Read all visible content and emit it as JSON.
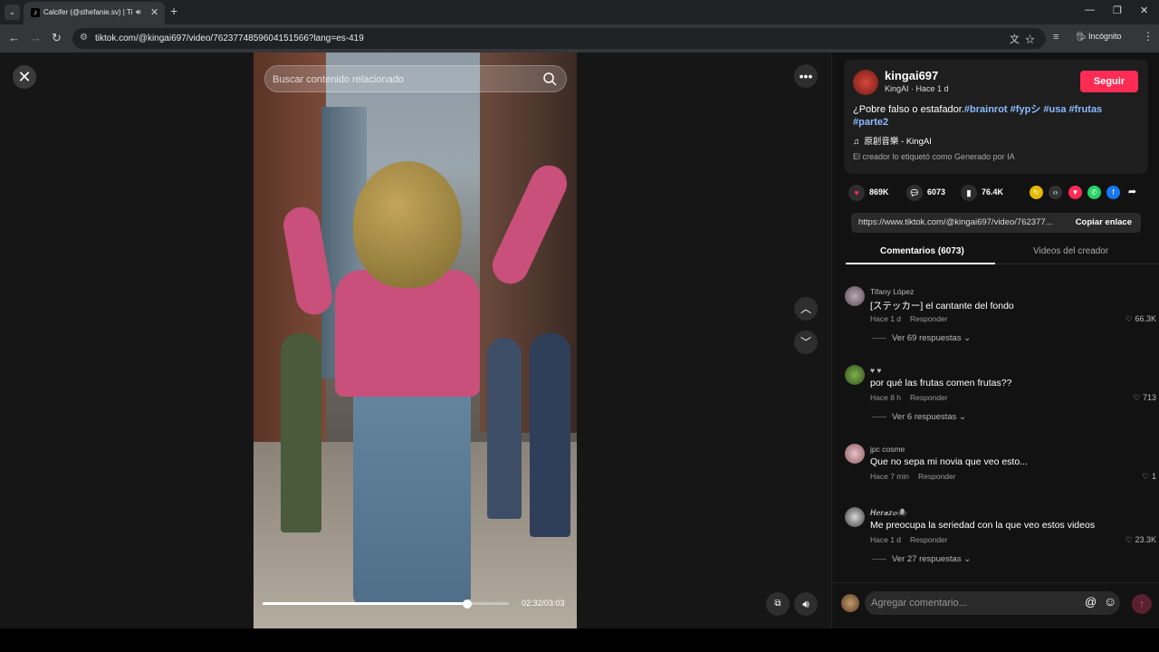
{
  "browser": {
    "tab_title": "Calcifer (@sthefanie.sv) | Ti",
    "url": "tiktok.com/@kingai697/video/7623774859604151566?lang=es-419",
    "incognito_label": "Incógnito"
  },
  "video": {
    "search_placeholder": "Buscar contenido relacionado",
    "time": "02:32/03:03",
    "progress_fraction": 0.83
  },
  "author": {
    "username": "kingai697",
    "subtitle": "KingAI · Hace 1 d",
    "follow_label": "Seguir",
    "desc_text": "¿Pobre falso o estafador.",
    "hashtags": [
      "#brainrot",
      "#fypシ",
      "#usa",
      "#frutas",
      "#parte2"
    ],
    "music": "原創音樂 - KingAI",
    "ai_label": "El creador lo etiquetó como Generado por IA"
  },
  "stats": {
    "likes": "869K",
    "comments": "6073",
    "saves": "76.4K"
  },
  "share": {
    "link": "https://www.tiktok.com/@kingai697/video/762377...",
    "copy_label": "Copiar enlace"
  },
  "tabs": {
    "comments": "Comentarios (6073)",
    "creator_videos": "Videos del creador"
  },
  "comments": [
    {
      "user": "Tifany López",
      "text": "[ステッカー] el cantante del fondo",
      "time": "Hace 1 d",
      "reply": "Responder",
      "likes": "66.3K",
      "more": "Ver 69 respuestas"
    },
    {
      "user": "♥ ♥",
      "text": "por qué las frutas comen frutas??",
      "time": "Hace 8 h",
      "reply": "Responder",
      "likes": "713",
      "more": "Ver 6 respuestas"
    },
    {
      "user": "jpc cosme",
      "text": "Que no sepa mi novia que veo esto...",
      "time": "Hace 7 min",
      "reply": "Responder",
      "likes": "1",
      "more": ""
    },
    {
      "user": "𝑯𝒆𝒓𝒂𝒛𝒐🕷",
      "text": "Me preocupa la seriedad con la que veo estos videos",
      "time": "Hace 1 d",
      "reply": "Responder",
      "likes": "23.3K",
      "more": "Ver 27 respuestas"
    }
  ],
  "composer": {
    "placeholder": "Agregar comentario..."
  }
}
